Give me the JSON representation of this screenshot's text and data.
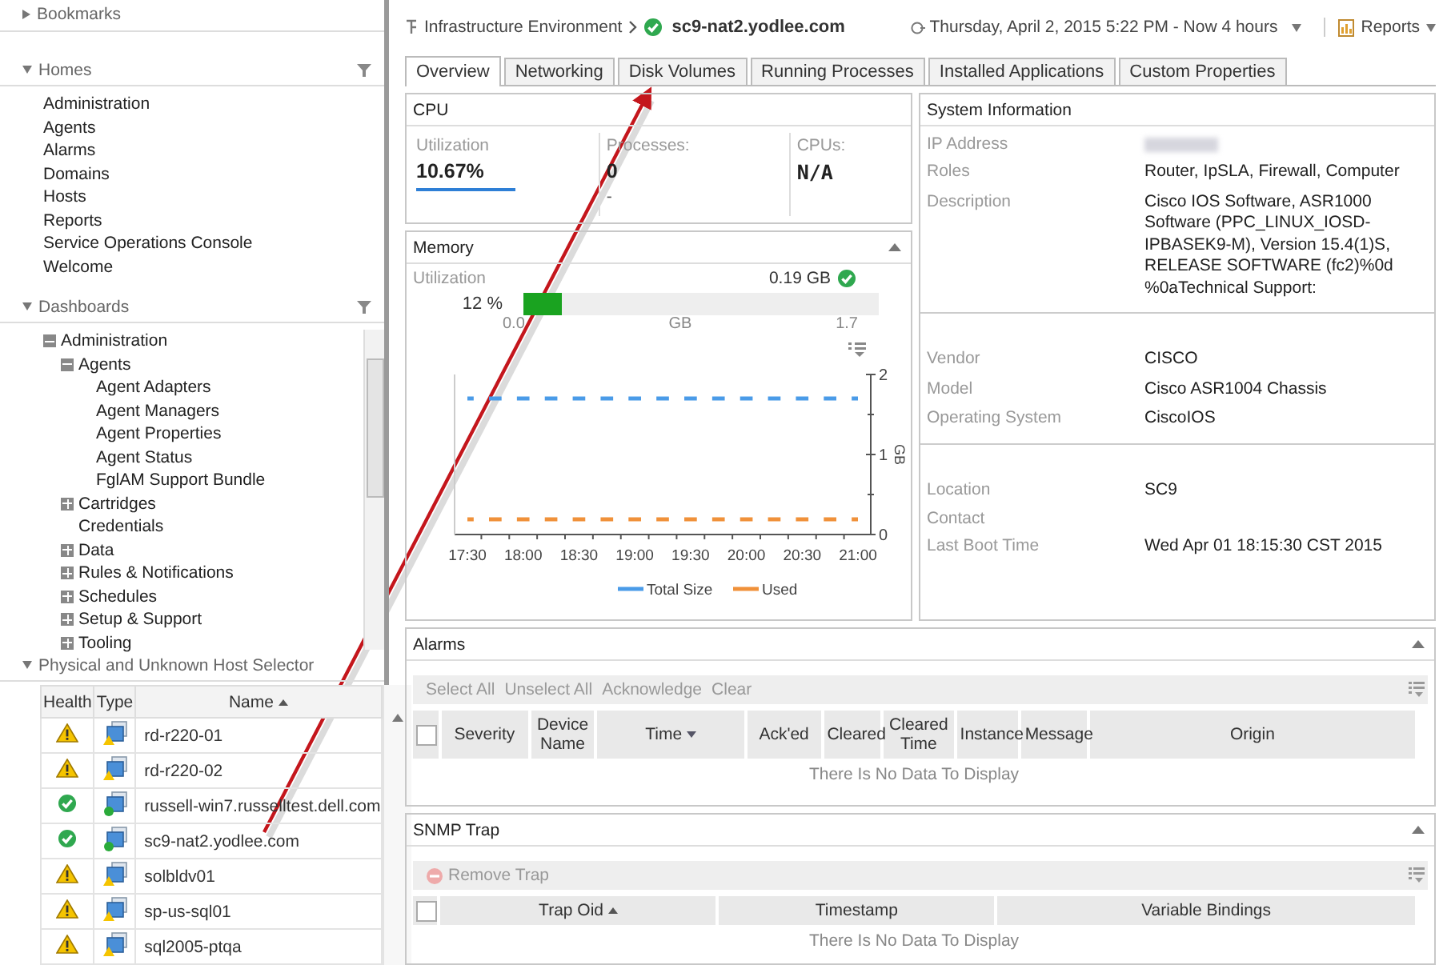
{
  "sidebar": {
    "bookmarks": {
      "title": "Bookmarks",
      "expanded": false
    },
    "homes": {
      "title": "Homes",
      "expanded": true,
      "items": [
        "Administration",
        "Agents",
        "Alarms",
        "Domains",
        "Hosts",
        "Reports",
        "Service Operations Console",
        "Welcome"
      ]
    },
    "dashboards": {
      "title": "Dashboards",
      "expanded": true,
      "tree": [
        {
          "label": "Administration",
          "kind": "group",
          "expanded": true,
          "children": [
            {
              "label": "Agents",
              "kind": "group",
              "expanded": true,
              "children": [
                {
                  "label": "Agent Adapters",
                  "kind": "leaf"
                },
                {
                  "label": "Agent Managers",
                  "kind": "leaf"
                },
                {
                  "label": "Agent Properties",
                  "kind": "leaf"
                },
                {
                  "label": "Agent Status",
                  "kind": "leaf"
                },
                {
                  "label": "FglAM Support Bundle",
                  "kind": "leaf"
                }
              ]
            },
            {
              "label": "Cartridges",
              "kind": "group",
              "expanded": false
            },
            {
              "label": "Credentials",
              "kind": "leaf"
            },
            {
              "label": "Data",
              "kind": "group",
              "expanded": false
            },
            {
              "label": "Rules & Notifications",
              "kind": "group",
              "expanded": false
            },
            {
              "label": "Schedules",
              "kind": "group",
              "expanded": false
            },
            {
              "label": "Setup & Support",
              "kind": "group",
              "expanded": false
            },
            {
              "label": "Tooling",
              "kind": "group",
              "expanded": false
            }
          ]
        }
      ]
    },
    "host_selector": {
      "title": "Physical and Unknown Host Selector",
      "expanded": true,
      "columns": [
        {
          "label": "Health",
          "sorted": false
        },
        {
          "label": "Type",
          "sorted": false
        },
        {
          "label": "Name",
          "sorted": true,
          "descending": false
        }
      ],
      "rows": [
        {
          "healthy": false,
          "type_healthy": false,
          "name": "rd-r220-01"
        },
        {
          "healthy": false,
          "type_healthy": false,
          "name": "rd-r220-02"
        },
        {
          "healthy": true,
          "type_healthy": true,
          "name": "russell-win7.russelltest.dell.com"
        },
        {
          "healthy": true,
          "type_healthy": true,
          "name": "sc9-nat2.yodlee.com"
        },
        {
          "healthy": false,
          "type_healthy": false,
          "name": "solbldv01"
        },
        {
          "healthy": false,
          "type_healthy": false,
          "name": "sp-us-sql01"
        },
        {
          "healthy": false,
          "type_healthy": false,
          "name": "sql2005-ptqa"
        }
      ]
    }
  },
  "breadcrumb": {
    "parent": "Infrastructure Environment",
    "current": "sc9-nat2.yodlee.com",
    "healthy": true
  },
  "time_range": "Thursday, April 2, 2015 5:22 PM - Now 4 hours",
  "reports": "Reports",
  "tabs": [
    {
      "label": "Overview",
      "selected": true
    },
    {
      "label": "Networking",
      "selected": false
    },
    {
      "label": "Disk Volumes",
      "selected": false
    },
    {
      "label": "Running Processes",
      "selected": false
    },
    {
      "label": "Installed Applications",
      "selected": false
    },
    {
      "label": "Custom Properties",
      "selected": false
    }
  ],
  "cpu": {
    "title": "CPU",
    "metrics": [
      {
        "label": "Utilization",
        "value": "10.67%",
        "kind": "sparkline"
      },
      {
        "label": "Processes:",
        "value": "0",
        "kind": "note",
        "note": "-"
      },
      {
        "label": "CPUs:",
        "value": "N/A",
        "kind": "plain"
      }
    ]
  },
  "memory": {
    "title": "Memory",
    "expanded": true,
    "label": "Utilization",
    "value": "0.19 GB",
    "healthy": true,
    "percent": "12 %",
    "level": 0.11,
    "scale": [
      "0.0",
      "GB",
      "1.7"
    ],
    "chart_data": {
      "type": "line",
      "ylabel": "GB",
      "categories": [
        "17:30",
        "18:00",
        "18:30",
        "19:00",
        "19:30",
        "20:00",
        "20:30",
        "21:00"
      ],
      "ylim": [
        0,
        2
      ],
      "yticks": [
        0,
        1,
        2
      ],
      "legend": "bottom",
      "series": [
        {
          "name": "Total Size",
          "color": "#4a9be8",
          "line_style": "dashed",
          "values": [
            1.7,
            1.7,
            1.7,
            1.7,
            1.7,
            1.7,
            1.7,
            1.7
          ]
        },
        {
          "name": "Used",
          "color": "#f0913a",
          "line_style": "dashed",
          "values": [
            0.19,
            0.19,
            0.19,
            0.19,
            0.19,
            0.19,
            0.19,
            0.19
          ]
        }
      ]
    }
  },
  "system_info": {
    "title": "System Information",
    "groups": [
      [
        {
          "label": "IP Address",
          "redacted": true
        },
        {
          "label": "Roles",
          "value": "Router, IpSLA, Firewall, Computer"
        },
        {
          "label": "Description",
          "value": "Cisco IOS Software, ASR1000 Software (PPC_LINUX_IOSD-IPBASEK9-M), Version 15.4(1)S, RELEASE SOFTWARE (fc2)%0d %0aTechnical Support:"
        }
      ],
      [
        {
          "label": "Vendor",
          "value": "CISCO"
        },
        {
          "label": "Model",
          "value": "Cisco ASR1004 Chassis"
        },
        {
          "label": "Operating System",
          "value": "CiscoIOS"
        }
      ],
      [
        {
          "label": "Location",
          "value": "SC9"
        },
        {
          "label": "Contact"
        },
        {
          "label": "Last Boot Time",
          "value": "Wed Apr 01 18:15:30 CST 2015"
        }
      ]
    ]
  },
  "alarms": {
    "title": "Alarms",
    "expanded": true,
    "all_selected": false,
    "actions": [
      {
        "label": "Select All",
        "disabled": true
      },
      {
        "label": "Unselect All",
        "disabled": true
      },
      {
        "label": "Acknowledge",
        "disabled": true
      },
      {
        "label": "Clear",
        "disabled": true
      }
    ],
    "columns": [
      {
        "label": "Severity",
        "sorted": false
      },
      {
        "label": "Device Name",
        "sorted": false
      },
      {
        "label": "Time",
        "sorted": true,
        "descending": true
      },
      {
        "label": "Ack'ed",
        "sorted": false
      },
      {
        "label": "Cleared",
        "sorted": false
      },
      {
        "label": "Cleared Time",
        "sorted": false
      },
      {
        "label": "Instance",
        "sorted": false
      },
      {
        "label": "Message",
        "sorted": false
      },
      {
        "label": "Origin",
        "sorted": false
      }
    ],
    "empty": "There Is No Data To Display"
  },
  "snmp_trap": {
    "title": "SNMP Trap",
    "expanded": true,
    "all_selected": false,
    "actions": [
      {
        "label": "Remove Trap",
        "disabled": true
      }
    ],
    "columns": [
      {
        "label": "Trap Oid",
        "sorted": true,
        "descending": false
      },
      {
        "label": "Timestamp",
        "sorted": false
      },
      {
        "label": "Variable Bindings",
        "sorted": false
      }
    ],
    "empty": "There Is No Data To Display"
  },
  "annotation_arrow": true
}
